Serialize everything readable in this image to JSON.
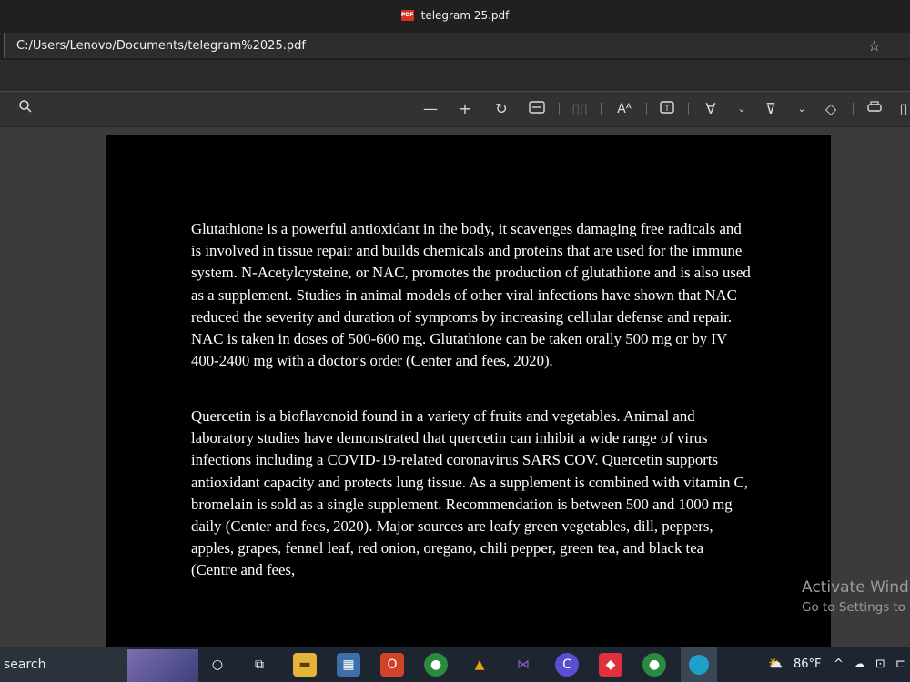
{
  "window": {
    "title": "telegram 25.pdf",
    "pdf_badge": "PDF"
  },
  "address": {
    "path": "C:/Users/Lenovo/Documents/telegram%2025.pdf"
  },
  "toolbar": {
    "icons": [
      "search-icon",
      "zoom-out-icon",
      "zoom-in-icon",
      "rotate-icon",
      "fit-width-icon",
      "page-view-icon",
      "read-aloud-icon",
      "text-box-icon",
      "draw-icon",
      "highlight-icon",
      "erase-icon",
      "print-icon"
    ]
  },
  "document": {
    "paragraphs": [
      "Glutathione is a powerful antioxidant in the body, it scavenges damaging free radicals and is involved in tissue repair and builds chemicals and proteins that are used for the immune system. N-Acetylcysteine, or NAC, promotes the production of glutathione and is also used as a supplement. Studies in animal models of other viral infections have shown that NAC reduced the severity and duration of symptoms by increasing cellular defense and repair. NAC is taken in doses of 500-600 mg. Glutathione can be taken orally 500 mg or by IV 400-2400 mg with a doctor's order (Center and fees, 2020).",
      "Quercetin is a bioflavonoid found in a variety of fruits and vegetables. Animal and laboratory studies have demonstrated that quercetin can inhibit a wide range of virus infections including a COVID-19-related coronavirus SARS COV. Quercetin supports antioxidant capacity and protects lung tissue. As a supplement is combined with vitamin C, bromelain is sold as a single supplement. Recommendation is between 500 and 1000 mg daily (Center and fees, 2020). Major sources are leafy green vegetables, dill, peppers, apples, grapes, fennel leaf, red onion, oregano, chili pepper, green tea, and black tea (Centre and fees,"
    ]
  },
  "watermark": {
    "line1": "Activate Wind",
    "line2": "Go to Settings to a"
  },
  "taskbar": {
    "search_label": "search",
    "weather": "86°F",
    "apps": [
      "task-view",
      "file-explorer",
      "calculator",
      "office",
      "chrome",
      "vlc",
      "visual-studio",
      "cortana",
      "anydesk",
      "chrome-2",
      "edge"
    ]
  },
  "colors": {
    "accent": "#0078d4",
    "page_bg": "#000000",
    "text": "#ffffff"
  }
}
